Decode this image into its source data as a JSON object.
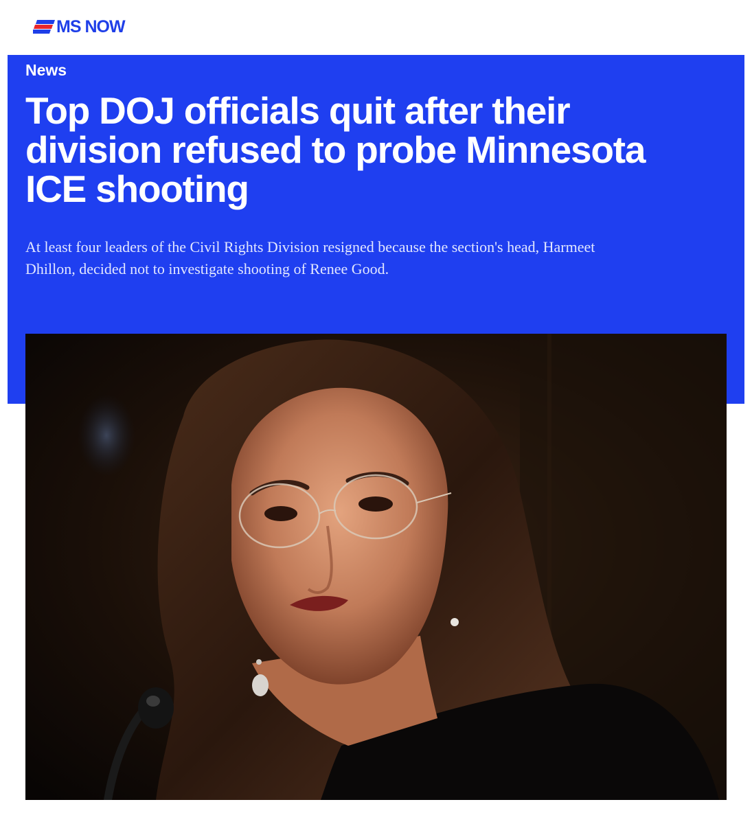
{
  "header": {
    "logo_text": "MS NOW",
    "brand_color": "#1f3fe8",
    "accent_color": "#e8262c"
  },
  "article": {
    "kicker": "News",
    "headline": "Top DOJ officials quit after their division refused to probe Minnesota ICE shooting",
    "dek": "At least four leaders of the Civil Rights Division resigned because the section's head, Harmeet Dhillon, decided not to investigate shooting of Renee Good.",
    "hero_color": "#1f3ff0"
  },
  "image": {
    "icon": "portrait-photo"
  }
}
